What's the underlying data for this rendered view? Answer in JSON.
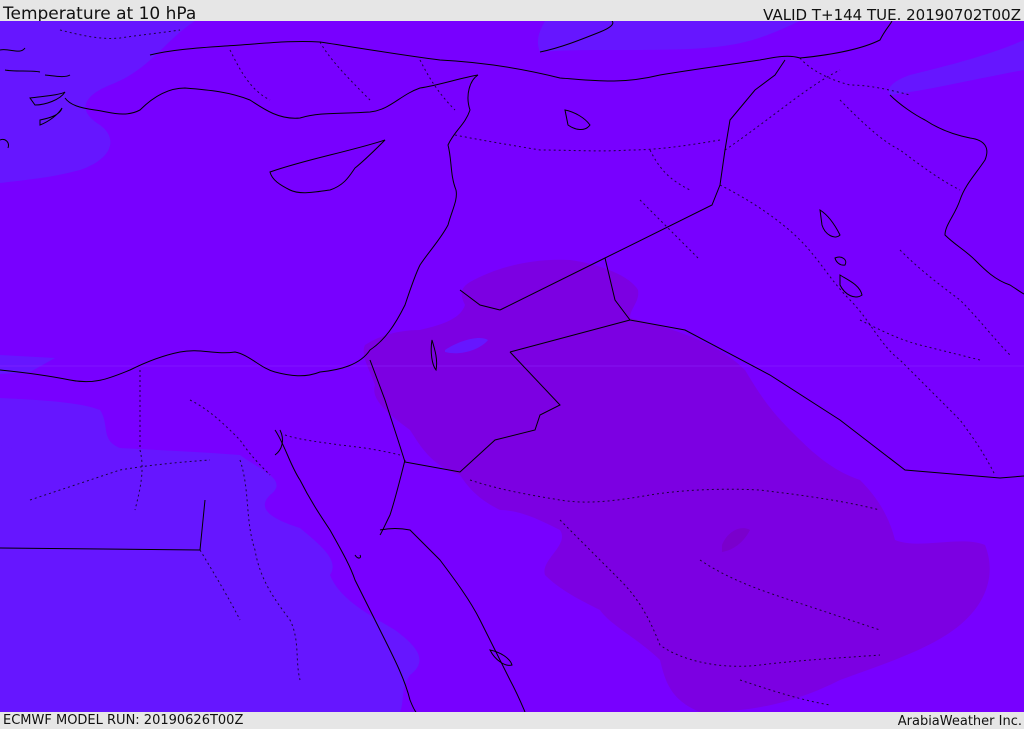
{
  "header": {
    "title": "Temperature at 10 hPa",
    "valid": "VALID T+144 TUE. 20190702T00Z"
  },
  "footer": {
    "model_run": "ECMWF MODEL RUN: 20190626T00Z",
    "credit": "ArabiaWeather Inc."
  },
  "map": {
    "region": "Eastern Mediterranean and Middle East",
    "base_color": "#7800ff",
    "cool_color": "#6616ff",
    "warm_color": "#7c00e2",
    "warmest_color": "#7a00cc",
    "coastline_color": "#000000",
    "border_style": "dotted"
  }
}
